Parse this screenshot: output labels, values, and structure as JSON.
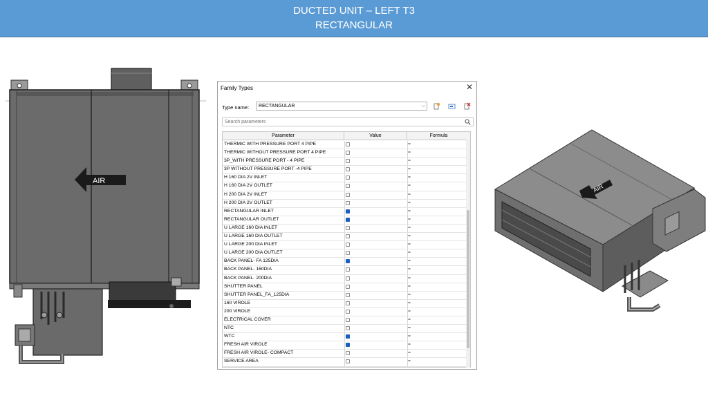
{
  "slide": {
    "title_line1": "DUCTED UNIT – LEFT T3",
    "title_line2": "RECTANGULAR",
    "plan_label": "AIR",
    "iso_label": "AIR"
  },
  "dialog": {
    "title": "Family Types",
    "close_glyph": "✕",
    "type_name_label": "Type name:",
    "type_name_value": "RECTANGULAR",
    "dropdown_glyph": "⌵",
    "search_placeholder": "Search parameters",
    "columns": {
      "parameter": "Parameter",
      "value": "Value",
      "formula": "Formula"
    },
    "rows": [
      {
        "name": "THERMIC WITH PRESSURE PORT 4 PIPE",
        "checked": false,
        "formula": "="
      },
      {
        "name": "THERMIC WITHOUT PRESSURE PORT  4 PIPE",
        "checked": false,
        "formula": "="
      },
      {
        "name": "3P_WITH PRESSURE PORT - 4 PIPE",
        "checked": false,
        "formula": "="
      },
      {
        "name": "3P WITHOUT PRESSURE PORT -4  PIPE",
        "checked": false,
        "formula": "="
      },
      {
        "name": "H 160 DIA 2V INLET",
        "checked": false,
        "formula": "="
      },
      {
        "name": "H 160 DIA 2V OUTLET",
        "checked": false,
        "formula": "="
      },
      {
        "name": "H 200 DIA 2V INLET",
        "checked": false,
        "formula": "="
      },
      {
        "name": "H 200 DIA 2V OUTLET",
        "checked": false,
        "formula": "="
      },
      {
        "name": "RECTANGULAR INLET",
        "checked": true,
        "formula": "="
      },
      {
        "name": "RECTANGULAR  OUTLET",
        "checked": true,
        "formula": "="
      },
      {
        "name": "U LARGE 160 DIA INLET",
        "checked": false,
        "formula": "="
      },
      {
        "name": "U LARGE 160 DIA OUTLET",
        "checked": false,
        "formula": "="
      },
      {
        "name": "U LARGE 200 DIA INLET",
        "checked": false,
        "formula": "="
      },
      {
        "name": "U LARGE 200 DIA OUTLET",
        "checked": false,
        "formula": "="
      },
      {
        "name": "BACK PANEL- FA 125DIA",
        "checked": true,
        "formula": "="
      },
      {
        "name": "BACK PANEL- 160DIA",
        "checked": false,
        "formula": "="
      },
      {
        "name": "BACK PANEL- 200DIA",
        "checked": false,
        "formula": "="
      },
      {
        "name": "SHUTTER PANEL",
        "checked": false,
        "formula": "="
      },
      {
        "name": "SHUTTER PANEL_FA_125DIA",
        "checked": false,
        "formula": "="
      },
      {
        "name": "160 VIROLE",
        "checked": false,
        "formula": "="
      },
      {
        "name": "200 VIROLE",
        "checked": false,
        "formula": "="
      },
      {
        "name": "ELECTRICAL COVER",
        "checked": false,
        "formula": "="
      },
      {
        "name": "NTC",
        "checked": false,
        "formula": "="
      },
      {
        "name": "WTC",
        "checked": true,
        "formula": "="
      },
      {
        "name": "FRESH AIR VIROLE",
        "checked": true,
        "formula": "="
      },
      {
        "name": "FRESH AIR VIROLE- COMPACT",
        "checked": false,
        "formula": "="
      },
      {
        "name": "SERVICE AREA",
        "checked": false,
        "formula": "="
      }
    ]
  },
  "colors": {
    "title_bar": "#5b9bd5",
    "checkbox_on": "#1d5fbf",
    "unit_body": "#696969"
  },
  "icons": {
    "new": "new-type-icon",
    "rename": "rename-type-icon",
    "delete": "delete-type-icon",
    "search": "search-icon",
    "close": "close-icon"
  }
}
